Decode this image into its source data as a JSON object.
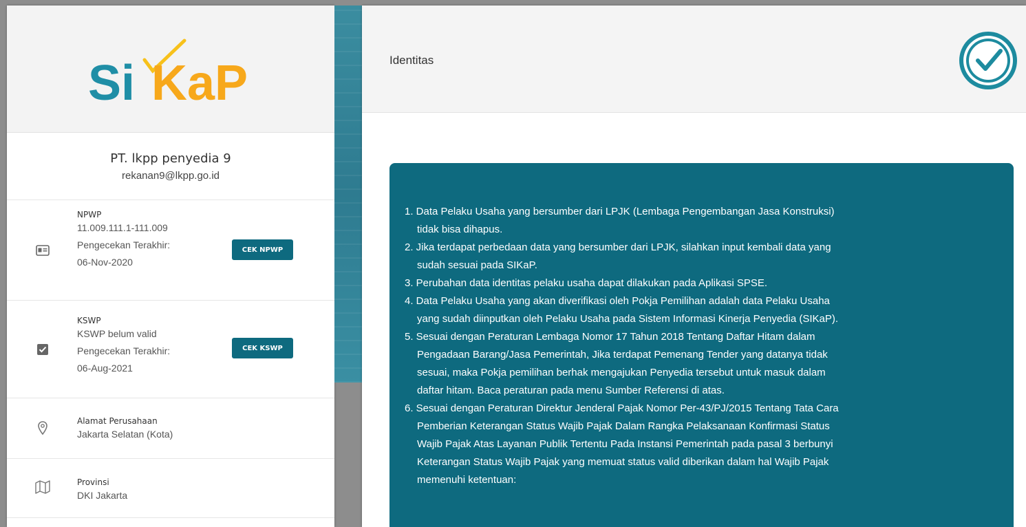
{
  "logo": {
    "text_si": "Si",
    "text_kap": "KaP",
    "colors": {
      "teal": "#1f8ea6",
      "orange": "#f7a81b",
      "check": "#f7c11b"
    }
  },
  "company": {
    "name": "PT. lkpp penyedia 9",
    "email": "rekanan9@lkpp.go.id"
  },
  "npwp": {
    "label": "NPWP",
    "value": "11.009.111.1-111.009",
    "check_label": "Pengecekan Terakhir:",
    "check_date": "06-Nov-2020",
    "button": "CEK NPWP",
    "icon": "id-card-icon"
  },
  "kswp": {
    "label": "KSWP",
    "value": "KSWP belum valid",
    "check_label": "Pengecekan Terakhir:",
    "check_date": "06-Aug-2021",
    "button": "CEK KSWP",
    "icon": "checkbox-icon"
  },
  "address": {
    "label": "Alamat Perusahaan",
    "value": "Jakarta Selatan (Kota)",
    "icon": "location-pin-icon"
  },
  "province": {
    "label": "Provinsi",
    "value": "DKI Jakarta",
    "icon": "map-icon"
  },
  "main": {
    "title": "Identitas",
    "badge_icon": "verified-badge-icon",
    "notice_lines": [
      "1. Data Pelaku Usaha yang bersumber dari LPJK (Lembaga Pengembangan Jasa Konstruksi)",
      "tidak bisa dihapus.",
      "2. Jika terdapat perbedaan data yang bersumber dari LPJK, silahkan input kembali data yang",
      "sudah sesuai pada SIKaP.",
      "3. Perubahan data identitas pelaku usaha dapat dilakukan pada Aplikasi SPSE.",
      "4. Data Pelaku Usaha yang akan diverifikasi oleh Pokja Pemilihan adalah data Pelaku Usaha",
      "yang sudah diinputkan oleh Pelaku Usaha pada Sistem Informasi Kinerja Penyedia (SIKaP).",
      "5. Sesuai dengan Peraturan Lembaga Nomor 17 Tahun 2018 Tentang Daftar Hitam dalam",
      "Pengadaan Barang/Jasa Pemerintah, Jika terdapat Pemenang Tender yang datanya tidak",
      "sesuai, maka Pokja pemilihan berhak mengajukan Penyedia tersebut untuk masuk dalam",
      "daftar hitam. Baca peraturan pada menu Sumber Referensi di atas.",
      "6. Sesuai dengan Peraturan Direktur Jenderal Pajak Nomor Per-43/PJ/2015 Tentang Tata Cara",
      "Pemberian Keterangan Status Wajib Pajak Dalam Rangka Pelaksanaan Konfirmasi Status",
      "Wajib Pajak Atas Layanan Publik Tertentu Pada Instansi Pemerintah pada pasal 3 berbunyi",
      "Keterangan Status Wajib Pajak yang memuat status valid diberikan dalam hal Wajib Pajak",
      "memenuhi ketentuan:"
    ]
  }
}
